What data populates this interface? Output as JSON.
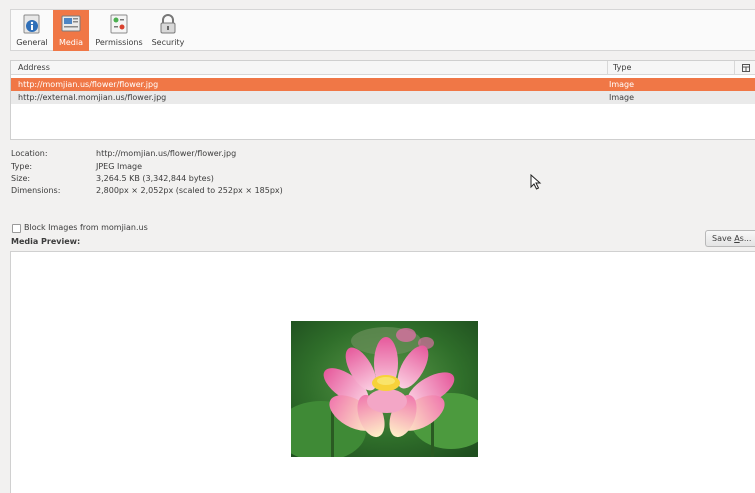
{
  "toolbar": {
    "tabs": [
      {
        "label": "General",
        "icon": "info-icon"
      },
      {
        "label": "Media",
        "icon": "media-icon",
        "active": true
      },
      {
        "label": "Permissions",
        "icon": "permissions-icon"
      },
      {
        "label": "Security",
        "icon": "lock-icon"
      }
    ]
  },
  "media_list": {
    "columns": [
      "Address",
      "Type"
    ],
    "column_picker_icon": "column-picker-icon",
    "rows": [
      {
        "address": "http://momjian.us/flower/flower.jpg",
        "type": "Image",
        "selected": true
      },
      {
        "address": "http://external.momjian.us/flower.jpg",
        "type": "Image",
        "selected": false
      }
    ]
  },
  "details": {
    "location_label": "Location:",
    "location_value": "http://momjian.us/flower/flower.jpg",
    "type_label": "Type:",
    "type_value": "JPEG Image",
    "size_label": "Size:",
    "size_value": "3,264.5 KB (3,342,844 bytes)",
    "dimensions_label": "Dimensions:",
    "dimensions_value": "2,800px × 2,052px (scaled to 252px × 185px)"
  },
  "block": {
    "label": "Block Images from momjian.us",
    "checked": false
  },
  "preview": {
    "label": "Media Preview:"
  },
  "save_as": {
    "label_prefix": "Save ",
    "label_underlined": "A",
    "label_suffix": "s..."
  },
  "colors": {
    "accent": "#f07746",
    "background": "#f2f1f0"
  }
}
